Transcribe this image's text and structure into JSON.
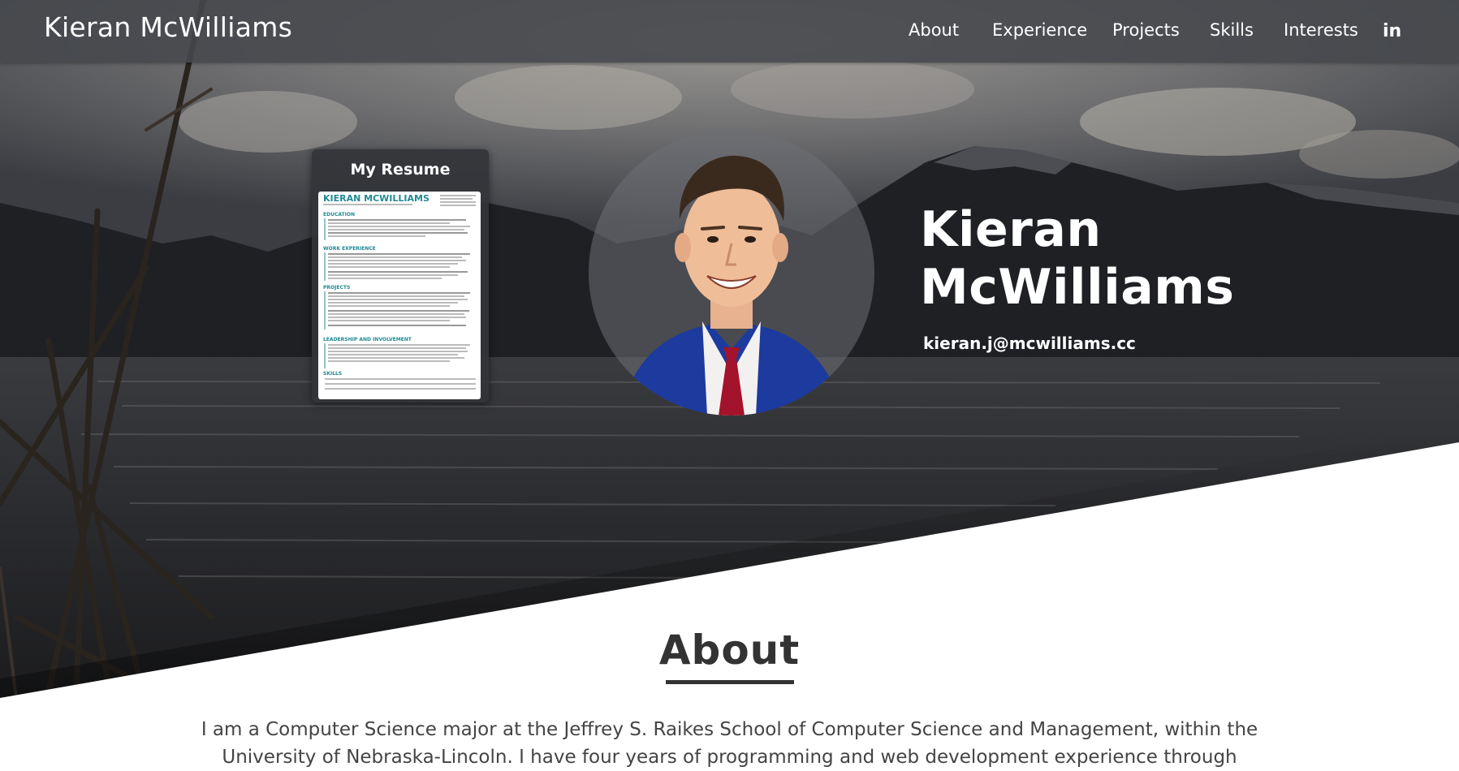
{
  "nav": {
    "brand": "Kieran McWilliams",
    "links": [
      {
        "label": "About"
      },
      {
        "label": "Experience"
      },
      {
        "label": "Projects"
      },
      {
        "label": "Skills"
      },
      {
        "label": "Interests"
      }
    ],
    "social_icon": "linkedin-icon",
    "social_glyph": "in"
  },
  "hero": {
    "resume_title": "My Resume",
    "resume_header": "KIERAN MCWILLIAMS",
    "resume_sections": [
      "EDUCATION",
      "WORK EXPERIENCE",
      "PROJECTS",
      "LEADERSHIP AND INVOLVEMENT",
      "SKILLS"
    ],
    "name_line1": "Kieran",
    "name_line2": "McWilliams",
    "email": "kieran.j@mcwilliams.cc"
  },
  "about": {
    "heading": "About",
    "text": "I am a Computer Science major at the Jeffrey S. Raikes School of Computer Science and Management, within the University of Nebraska-Lincoln. I have four years of programming and web development experience through"
  },
  "colors": {
    "nav_bg": "#46484c",
    "accent_teal": "#1f8a93",
    "suit_blue": "#1d3a9e",
    "tie_red": "#a3132b",
    "text_dark": "#333333"
  }
}
